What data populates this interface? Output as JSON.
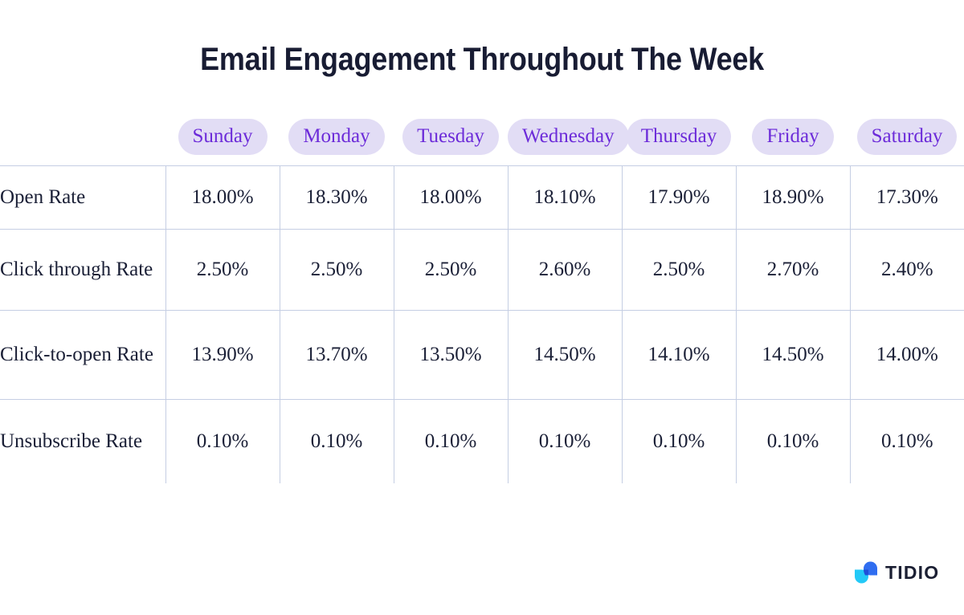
{
  "page": {
    "title": "Email Engagement Throughout The Week",
    "background_color": "#ffffff"
  },
  "colors": {
    "title_text": "#181c33",
    "pill_background": "#e2ddf5",
    "pill_text": "#6c2bd9",
    "grid_line": "#c5cee3",
    "cell_text": "#1a1f36",
    "logo_cyan": "#23c9f7",
    "logo_blue": "#2f6df0",
    "logo_overlap": "#1f4fd8",
    "logo_text": "#1b1f33"
  },
  "chart_data": {
    "type": "table",
    "title": "Email Engagement Throughout The Week",
    "row_header_label": "",
    "categories": [
      "Sunday",
      "Monday",
      "Tuesday",
      "Wednesday",
      "Thursday",
      "Friday",
      "Saturday"
    ],
    "series": [
      {
        "name": "Open Rate",
        "values": [
          "18.00%",
          "18.30%",
          "18.00%",
          "18.10%",
          "17.90%",
          "18.90%",
          "17.30%"
        ],
        "numeric": [
          18.0,
          18.3,
          18.0,
          18.1,
          17.9,
          18.9,
          17.3
        ]
      },
      {
        "name": "Click through Rate",
        "values": [
          "2.50%",
          "2.50%",
          "2.50%",
          "2.60%",
          "2.50%",
          "2.70%",
          "2.40%"
        ],
        "numeric": [
          2.5,
          2.5,
          2.5,
          2.6,
          2.5,
          2.7,
          2.4
        ]
      },
      {
        "name": "Click-to-open Rate",
        "values": [
          "13.90%",
          "13.70%",
          "13.50%",
          "14.50%",
          "14.10%",
          "14.50%",
          "14.00%"
        ],
        "numeric": [
          13.9,
          13.7,
          13.5,
          14.5,
          14.1,
          14.5,
          14.0
        ]
      },
      {
        "name": "Unsubscribe Rate",
        "values": [
          "0.10%",
          "0.10%",
          "0.10%",
          "0.10%",
          "0.10%",
          "0.10%",
          "0.10%"
        ],
        "numeric": [
          0.1,
          0.1,
          0.1,
          0.1,
          0.1,
          0.1,
          0.1
        ]
      }
    ],
    "grid": true,
    "legend": "none"
  },
  "table": {
    "headers": [
      "Sunday",
      "Monday",
      "Tuesday",
      "Wednesday",
      "Thursday",
      "Friday",
      "Saturday"
    ],
    "rows": [
      {
        "label": "Open Rate",
        "cells": [
          "18.00%",
          "18.30%",
          "18.00%",
          "18.10%",
          "17.90%",
          "18.90%",
          "17.30%"
        ]
      },
      {
        "label": "Click through Rate",
        "cells": [
          "2.50%",
          "2.50%",
          "2.50%",
          "2.60%",
          "2.50%",
          "2.70%",
          "2.40%"
        ]
      },
      {
        "label": "Click-to-open Rate",
        "cells": [
          "13.90%",
          "13.70%",
          "13.50%",
          "14.50%",
          "14.10%",
          "14.50%",
          "14.00%"
        ]
      },
      {
        "label": "Unsubscribe Rate",
        "cells": [
          "0.10%",
          "0.10%",
          "0.10%",
          "0.10%",
          "0.10%",
          "0.10%",
          "0.10%"
        ]
      }
    ]
  },
  "branding": {
    "logo_text": "TIDIO",
    "logo_icon": "tidio-chat-bubble-icon"
  }
}
